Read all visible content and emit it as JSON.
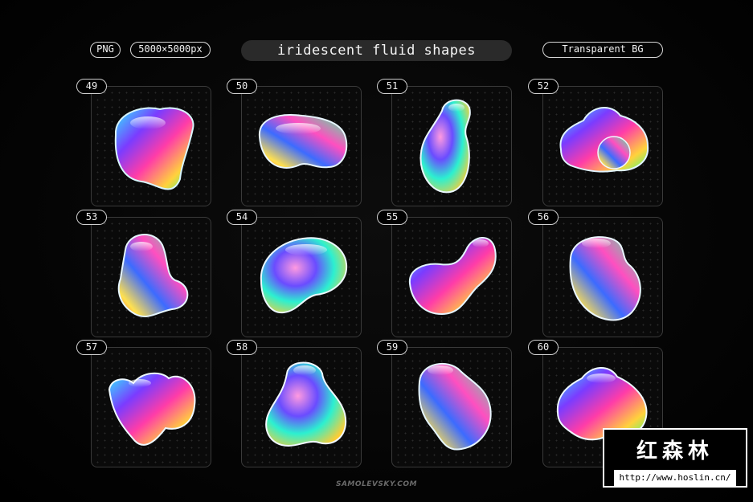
{
  "header": {
    "format": "PNG",
    "size": "5000×5000px",
    "title": "iridescent fluid shapes",
    "background": "Transparent BG"
  },
  "tiles": [
    {
      "number": "49"
    },
    {
      "number": "50"
    },
    {
      "number": "51"
    },
    {
      "number": "52"
    },
    {
      "number": "53"
    },
    {
      "number": "54"
    },
    {
      "number": "55"
    },
    {
      "number": "56"
    },
    {
      "number": "57"
    },
    {
      "number": "58"
    },
    {
      "number": "59"
    },
    {
      "number": "60"
    }
  ],
  "footer": {
    "credit": "SAMOLEVSKY.COM"
  },
  "watermark": {
    "brand": "红森林",
    "url": "http://www.hoslin.cn/"
  },
  "colors": {
    "background": "#000000",
    "tile_border": "#3a3a3a",
    "pill_border": "#d8d8d8",
    "title_pill": "#2a2a2a"
  }
}
